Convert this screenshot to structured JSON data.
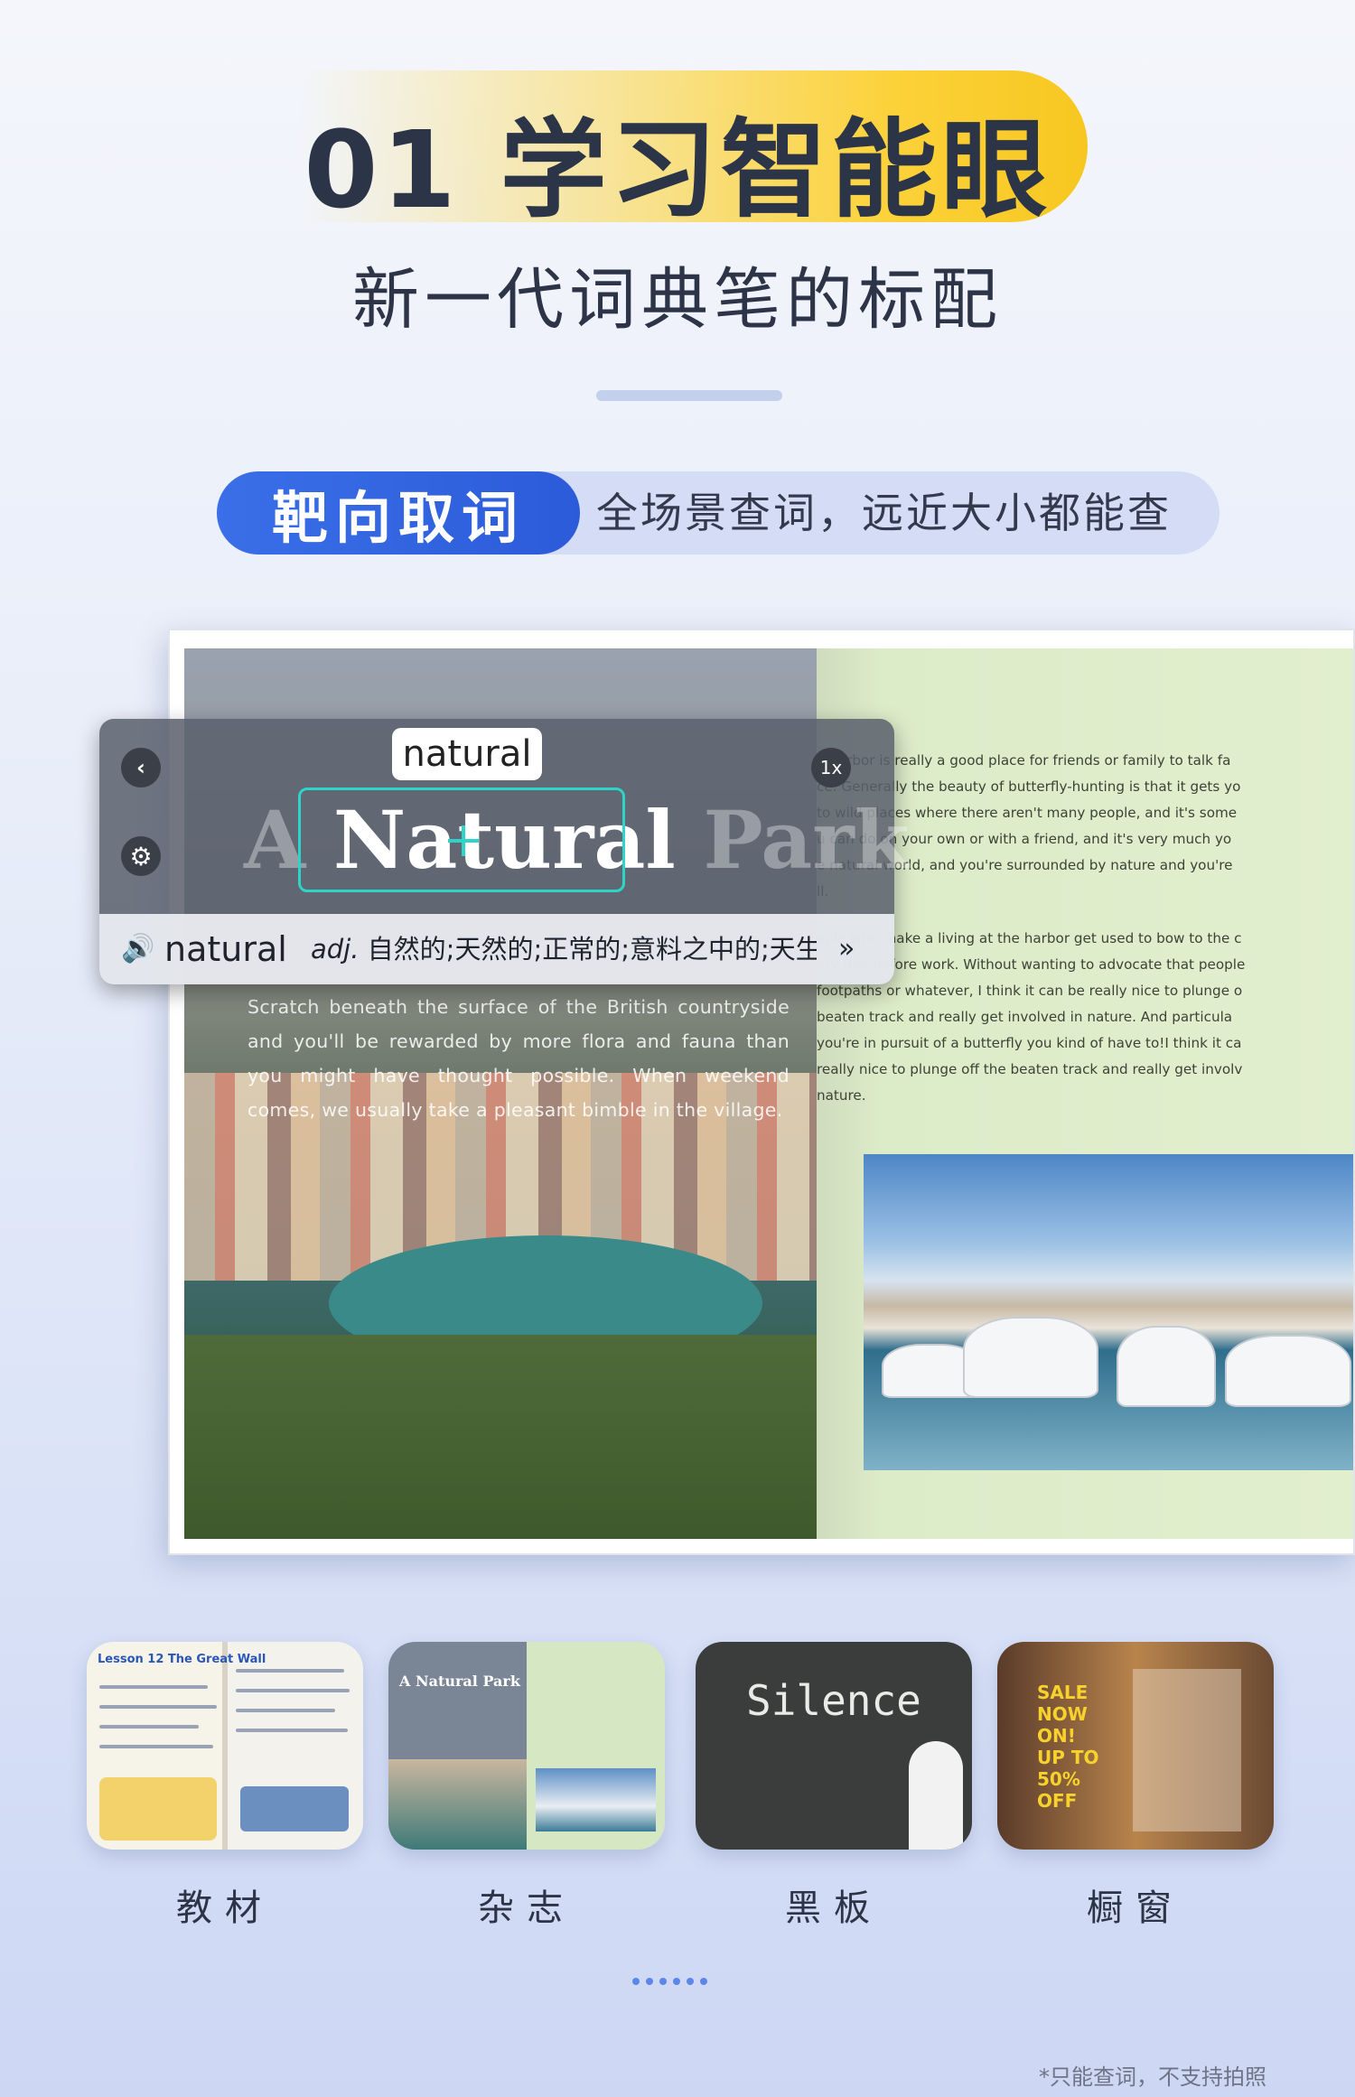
{
  "header": {
    "title": "01 学习智能眼",
    "subtitle": "新一代词典笔的标配"
  },
  "feature": {
    "label": "靶向取词",
    "description": "全场景查词，远近大小都能查"
  },
  "book": {
    "left_title": "A Natural Park",
    "left_paragraph": "Scratch beneath the surface of the British countryside and you'll be rewarded by more flora and fauna than you might have thought possible. When weekend comes, we usually take a pleasant bimble in the village.",
    "right_lines": [
      "e harbor is really a good place for friends or family to talk fa",
      "ce. Generally the beauty of butterfly-hunting is that it gets yo",
      "to wild places where there aren't many people, and it's some",
      "u can do on your own or with a friend, and it's very much yo",
      "e natural world, and you're surrounded by nature and you're",
      "ll.",
      "ople who make a living at the harbor get used to bow to the c",
      "ery day before work. Without wanting to advocate that people",
      "footpaths or whatever, I think it can be really nice to plunge o",
      "beaten track and really get involved in nature. And particula",
      "you're in pursuit of a butterfly you kind of have to!I think it ca",
      "really nice to plunge off the beaten track and really get involv",
      "nature."
    ]
  },
  "scanner": {
    "back_glyph": "‹",
    "zoom": "1x",
    "settings_glyph": "⚙",
    "captured_chip": "natural",
    "scan_prefix": "A ",
    "scan_hit": "Natural",
    "scan_suffix": " Park",
    "speaker_glyph": "🔊",
    "result_word": "natural",
    "result_pos": "adj.",
    "result_def": " 自然的;天然的;正常的;意料之中的;天生...",
    "more_glyph": "»"
  },
  "scenes": [
    {
      "label": "教材",
      "caption": "Lesson 12 The Great Wall"
    },
    {
      "label": "杂志",
      "caption": "A Natural Park"
    },
    {
      "label": "黑板",
      "caption": "Silence"
    },
    {
      "label": "橱窗",
      "caption": "SALE NOW ON! UP TO 50% OFF"
    }
  ],
  "footnote": "*只能查词，不支持拍照",
  "icons": {
    "back": "chevron-left-icon",
    "settings": "gear-icon",
    "speaker": "speaker-icon",
    "more": "double-chevron-right-icon"
  },
  "colors": {
    "accent_blue": "#2c5bd9",
    "highlight_yellow": "#fcd23a",
    "scan_cyan": "#2fd4c9"
  }
}
